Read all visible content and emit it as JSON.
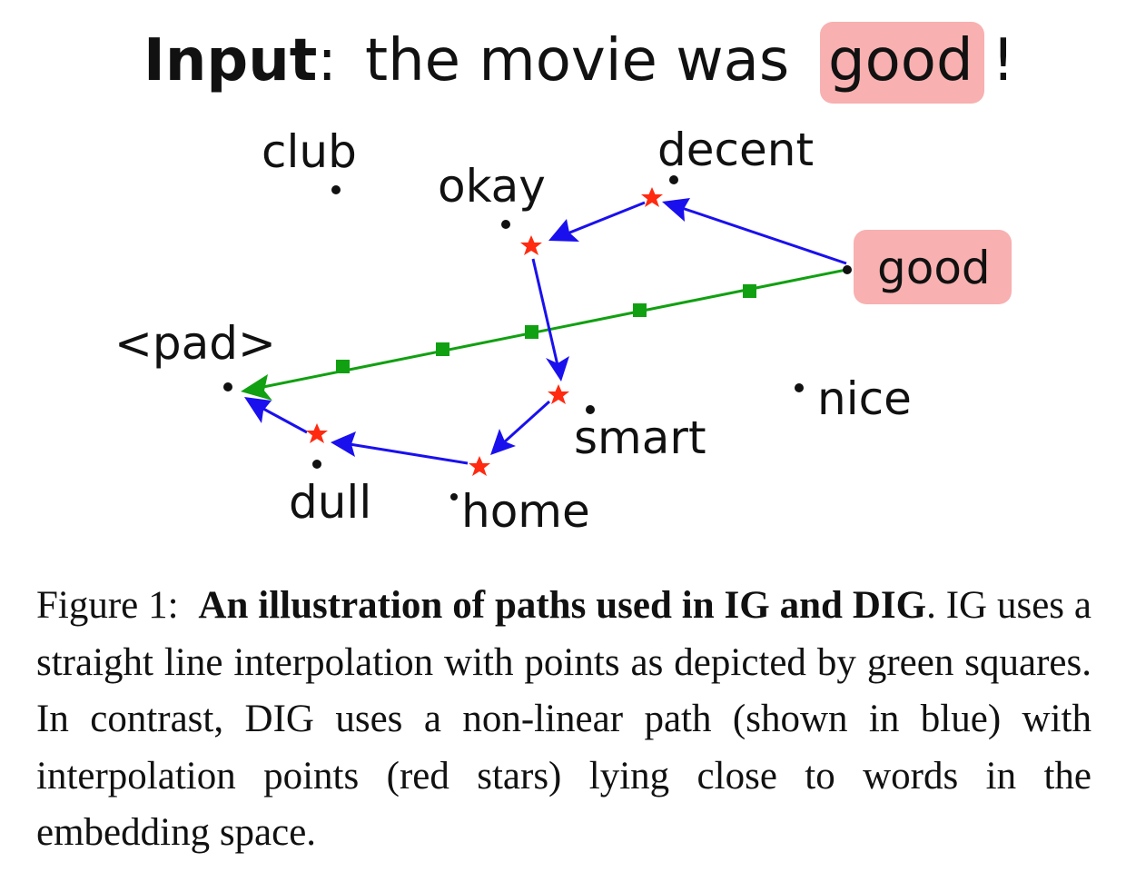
{
  "figure": {
    "input_label": "Input",
    "input_colon": ":",
    "input_pre": "the movie was",
    "input_highlight": "good",
    "input_post": "!",
    "highlight_color": "#f8b0b0",
    "ig_path_color": "#11a011",
    "dig_path_color": "#1a10ee",
    "star_color": "#ff2a10",
    "words": {
      "club": "club",
      "okay": "okay",
      "decent": "decent",
      "good": "good",
      "pad": "<pad>",
      "nice": "nice",
      "smart": "smart",
      "dull": "dull",
      "home": "home"
    }
  },
  "caption": {
    "figure_label": "Figure 1:",
    "bold_title": "An illustration of paths used in IG and DIG",
    "text": ". IG uses a straight line interpolation with points as depicted by green squares. In contrast, DIG uses a non-linear path (shown in blue) with interpolation points (red stars) lying close to words in the embedding space."
  }
}
